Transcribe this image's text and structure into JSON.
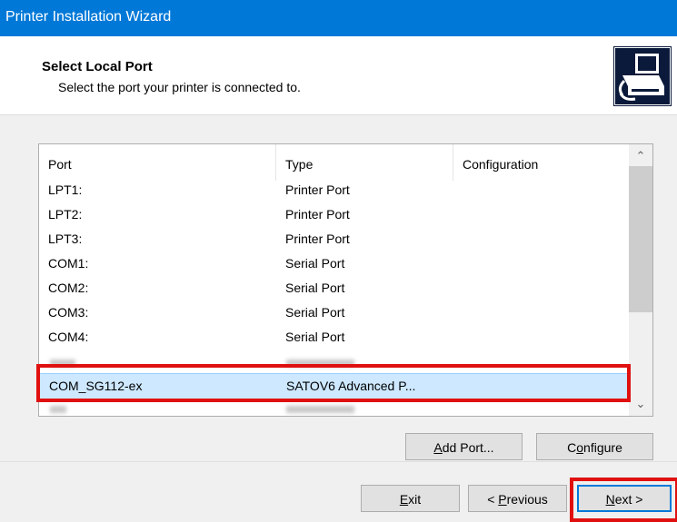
{
  "window": {
    "title": "Printer Installation Wizard"
  },
  "header": {
    "title": "Select Local Port",
    "subtitle": "Select the port your printer is connected to."
  },
  "port_list": {
    "columns": [
      "Port",
      "Type",
      "Configuration"
    ],
    "rows": [
      {
        "port": "LPT1:",
        "type": "Printer Port"
      },
      {
        "port": "LPT2:",
        "type": "Printer Port"
      },
      {
        "port": "LPT3:",
        "type": "Printer Port"
      },
      {
        "port": "COM1:",
        "type": "Serial Port"
      },
      {
        "port": "COM2:",
        "type": "Serial Port"
      },
      {
        "port": "COM3:",
        "type": "Serial Port"
      },
      {
        "port": "COM4:",
        "type": "Serial Port"
      },
      {
        "port": "COM_SG112-ex",
        "type": "SATOV6 Advanced P...",
        "selected": true
      }
    ]
  },
  "buttons": {
    "add_port": {
      "pre": "",
      "mnemonic": "A",
      "post": "dd Port..."
    },
    "configure": {
      "pre": "C",
      "mnemonic": "o",
      "post": "nfigure"
    },
    "exit": {
      "pre": "",
      "mnemonic": "E",
      "post": "xit"
    },
    "previous": {
      "pre": "< ",
      "mnemonic": "P",
      "post": "revious"
    },
    "next": {
      "pre": "",
      "mnemonic": "N",
      "post": "ext >"
    }
  },
  "colors": {
    "titlebar": "#0078d7",
    "highlight": "#e01010",
    "selection": "#cde8ff"
  }
}
